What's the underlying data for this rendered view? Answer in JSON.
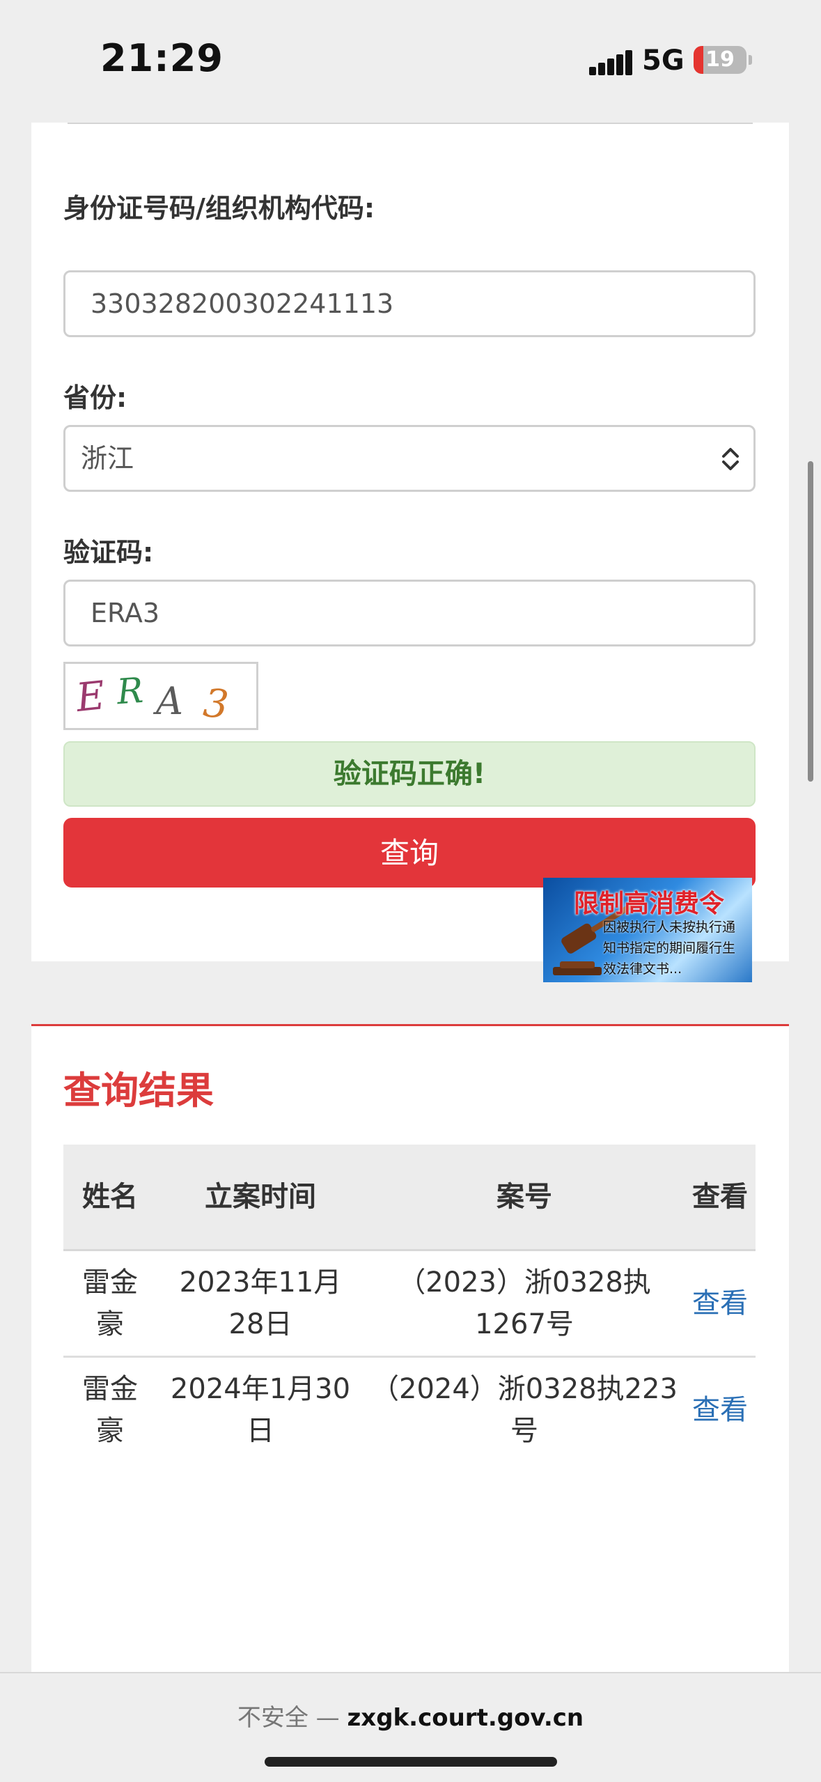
{
  "status_bar": {
    "time": "21:29",
    "network": "5G",
    "battery": "19",
    "battery_level": 0.19
  },
  "form": {
    "id_label": "身份证号码/组织机构代码:",
    "id_value": "330328200302241113",
    "province_label": "省份:",
    "province_value": "浙江",
    "captcha_label": "验证码:",
    "captcha_value": "ERA3",
    "captcha_image_text": "ERA3",
    "captcha_success": "验证码正确!",
    "query_button": "查询"
  },
  "ad": {
    "title": "限制高消费令",
    "body": "因被执行人未按执行通知书指定的期间履行生效法律文书..."
  },
  "results": {
    "title": "查询结果",
    "headers": [
      "姓名",
      "立案时间",
      "案号",
      "查看"
    ],
    "rows": [
      {
        "name": "雷金豪",
        "date": "2023年11月28日",
        "case_no": "（2023）浙0328执1267号",
        "view": "查看"
      },
      {
        "name": "雷金豪",
        "date": "2024年1月30日",
        "case_no": "（2024）浙0328执223号",
        "view": "查看"
      }
    ]
  },
  "browser": {
    "insecure_label": "不安全 —",
    "domain": "zxgk.court.gov.cn"
  },
  "colors": {
    "accent_red": "#e3353a",
    "title_red": "#dc3c3c",
    "link_blue": "#2a6fb5",
    "success_green": "#3c7a2f"
  }
}
